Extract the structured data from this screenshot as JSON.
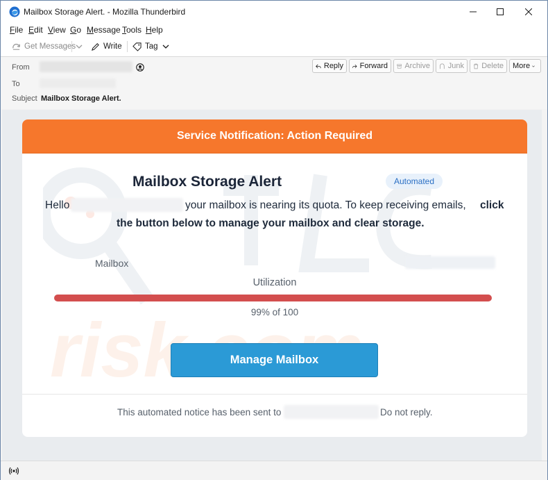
{
  "window": {
    "title": "Mailbox Storage Alert. - Mozilla Thunderbird"
  },
  "menu": {
    "items": [
      {
        "first": "F",
        "rest": "ile"
      },
      {
        "first": "E",
        "rest": "dit"
      },
      {
        "first": "V",
        "rest": "iew"
      },
      {
        "first": "G",
        "rest": "o"
      },
      {
        "first": "M",
        "rest": "essage"
      },
      {
        "first": "T",
        "rest": "ools"
      },
      {
        "first": "H",
        "rest": "elp"
      }
    ]
  },
  "toolbar": {
    "get_messages": "Get Messages",
    "write": "Write",
    "tag": "Tag"
  },
  "header": {
    "from_label": "From",
    "to_label": "To",
    "subject_label": "Subject",
    "subject": "Mailbox Storage Alert.",
    "actions": {
      "reply": "Reply",
      "forward": "Forward",
      "archive": "Archive",
      "junk": "Junk",
      "delete": "Delete",
      "more": "More"
    }
  },
  "email": {
    "banner": "Service Notification: Action Required",
    "heading": "Mailbox Storage Alert",
    "badge": "Automated",
    "hello": "Hello",
    "line1": "your mailbox is nearing its quota. To keep receiving emails,",
    "line1_bold": "click",
    "line2_bold": "the button below to manage your mailbox and clear storage.",
    "mailbox_label": "Mailbox",
    "utilization_label": "Utilization",
    "usage_text": "99% of 100",
    "usage_fraction": 0.99,
    "button": "Manage Mailbox",
    "footer_before": "This automated notice has been sent to",
    "footer_after": "Do not reply."
  },
  "colors": {
    "banner": "#f6772c",
    "button": "#2b9ad6",
    "bar": "#d34e4e",
    "badge_text": "#2a6fc4"
  },
  "icons": [
    "thunderbird-icon",
    "minimize-icon",
    "maximize-icon",
    "close-icon",
    "get-messages-icon",
    "dropdown-chevron-icon",
    "write-icon",
    "tag-icon",
    "contact-icon",
    "reply-icon",
    "forward-icon",
    "archive-icon",
    "junk-icon",
    "delete-icon",
    "online-status-icon"
  ]
}
